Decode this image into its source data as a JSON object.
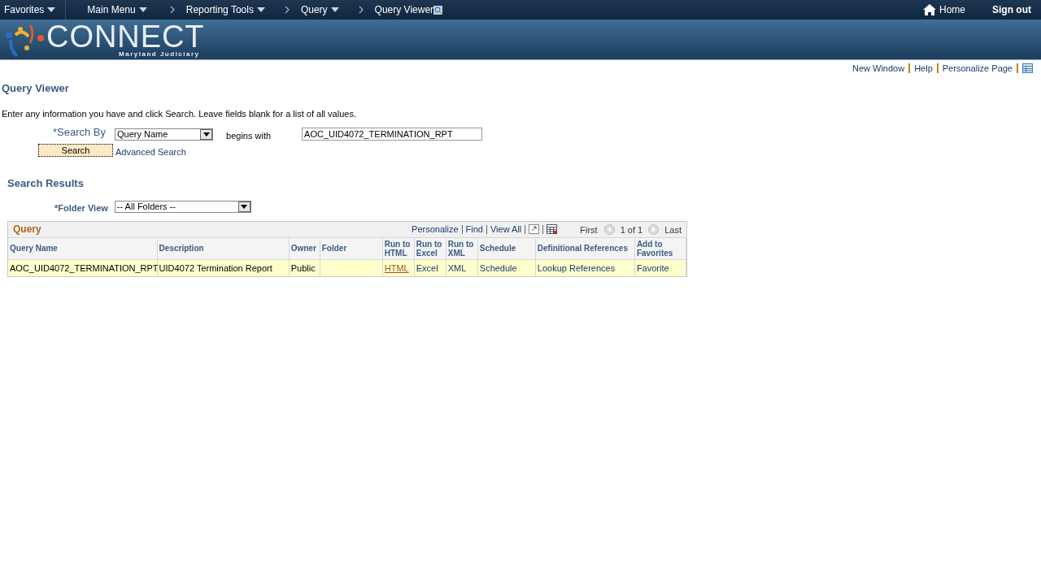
{
  "nav": {
    "items": [
      {
        "label": "Favorites",
        "dropdown": true,
        "chevron_before": false
      },
      {
        "label": "Main Menu",
        "dropdown": true,
        "chevron_before": false
      },
      {
        "label": "Reporting Tools",
        "dropdown": true,
        "chevron_before": true
      },
      {
        "label": "Query",
        "dropdown": true,
        "chevron_before": true
      },
      {
        "label": "Query Viewer",
        "dropdown": false,
        "chevron_before": true
      }
    ],
    "home": "Home",
    "sign_out": "Sign out"
  },
  "brand": {
    "name": "CONNECT",
    "subtitle": "Maryland Judiciary"
  },
  "page_links": [
    "New Window",
    "Help",
    "Personalize Page"
  ],
  "title": "Query Viewer",
  "instructions": "Enter any information you have and click Search. Leave fields blank for a list of all values.",
  "search": {
    "label": "*Search By",
    "field": "Query Name",
    "operator": "begins with",
    "value": "AOC_UID4072_TERMINATION_RPT",
    "button": "Search",
    "advanced": "Advanced Search"
  },
  "results": {
    "heading": "Search Results",
    "folder_label": "*Folder View",
    "folder_value": "-- All Folders --"
  },
  "grid": {
    "title": "Query",
    "tools": [
      "Personalize",
      "Find",
      "View All"
    ],
    "first": "First",
    "count": "1 of 1",
    "last": "Last",
    "columns": [
      "Query Name",
      "Description",
      "Owner",
      "Folder",
      "Run to HTML",
      "Run to Excel",
      "Run to XML",
      "Schedule",
      "Definitional References",
      "Add to Favorites"
    ],
    "rows": [
      {
        "cells": [
          {
            "text": "AOC_UID4072_TERMINATION_RPT",
            "kind": "text"
          },
          {
            "text": "UID4072 Termination Report",
            "kind": "text"
          },
          {
            "text": "Public",
            "kind": "text"
          },
          {
            "kind": "empty"
          },
          {
            "text": "HTML",
            "kind": "visited"
          },
          {
            "text": "Excel",
            "kind": "link"
          },
          {
            "text": "XML",
            "kind": "link"
          },
          {
            "text": "Schedule",
            "kind": "link"
          },
          {
            "text": "Lookup References",
            "kind": "link"
          },
          {
            "text": "Favorite",
            "kind": "link"
          }
        ]
      }
    ]
  }
}
